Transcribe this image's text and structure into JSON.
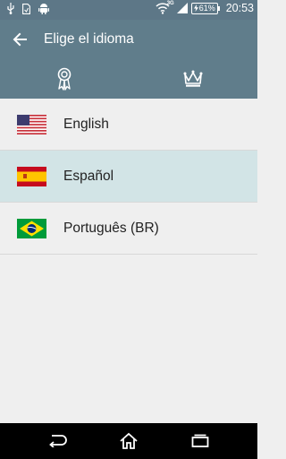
{
  "status_bar": {
    "network_label": "3G",
    "battery_text": "61%",
    "time": "20:53"
  },
  "app_bar": {
    "title": "Elige el idioma"
  },
  "tabs": [
    {
      "icon": "ribbon-award-icon"
    },
    {
      "icon": "crown-icon"
    }
  ],
  "languages": [
    {
      "label": "English",
      "flag": "us-flag-icon",
      "selected": false
    },
    {
      "label": "Español",
      "flag": "spain-flag-icon",
      "selected": true
    },
    {
      "label": "Português (BR)",
      "flag": "brazil-flag-icon",
      "selected": false
    }
  ],
  "colors": {
    "app_bar": "#607d8b",
    "status_bar": "#5d7787",
    "selected_row": "#d2e4e6",
    "background": "#efefef"
  }
}
